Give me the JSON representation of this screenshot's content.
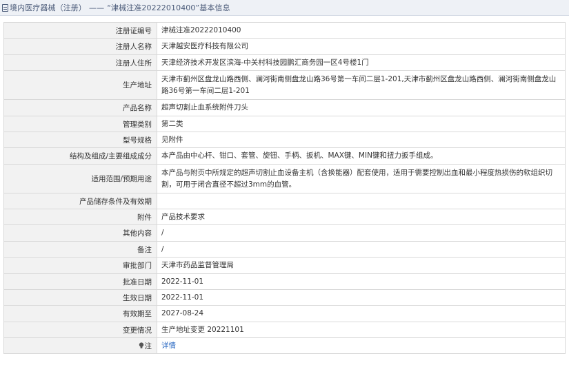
{
  "breadcrumb": {
    "section": "境内医疗器械（注册）",
    "separator": "——",
    "title": "“津械注准20222010400”基本信息"
  },
  "rows": [
    {
      "label": "注册证编号",
      "value": "津械注准20222010400"
    },
    {
      "label": "注册人名称",
      "value": "天津越安医疗科技有限公司"
    },
    {
      "label": "注册人住所",
      "value": "天津经济技术开发区滨海-中关村科技园鹏汇商务园一区4号楼1门"
    },
    {
      "label": "生产地址",
      "value": "天津市蓟州区盘龙山路西侧、澜河街南侧盘龙山路36号第一车间二层1-201,天津市蓟州区盘龙山路西侧、澜河街南侧盘龙山路36号第一车间二层1-201"
    },
    {
      "label": "产品名称",
      "value": "超声切割止血系统附件刀头"
    },
    {
      "label": "管理类别",
      "value": "第二类"
    },
    {
      "label": "型号规格",
      "value": "见附件"
    },
    {
      "label": "结构及组成/主要组成成分",
      "value": "本产品由中心杆、钳口、套管、旋钮、手柄、扳机、MAX键、MIN键和扭力扳手组成。"
    },
    {
      "label": "适用范围/预期用途",
      "value": "本产品与附页中所规定的超声切割止血设备主机（含换能器）配套使用，适用于需要控制出血和最小程度热损伤的软组织切割，可用于闭合直径不超过3mm的血管。"
    },
    {
      "label": "产品储存条件及有效期",
      "value": ""
    },
    {
      "label": "附件",
      "value": "产品技术要求"
    },
    {
      "label": "其他内容",
      "value": "/"
    },
    {
      "label": "备注",
      "value": "/"
    },
    {
      "label": "审批部门",
      "value": "天津市药品监督管理局"
    },
    {
      "label": "批准日期",
      "value": "2022-11-01"
    },
    {
      "label": "生效日期",
      "value": "2022-11-01"
    },
    {
      "label": "有效期至",
      "value": "2027-08-24"
    },
    {
      "label": "变更情况",
      "value": "生产地址变更 20221101"
    }
  ],
  "note_row": {
    "icon": "lightbulb-icon",
    "label": "注",
    "link_text": "详情"
  },
  "colors": {
    "topbar_bg": "#eef1f6",
    "label_bg": "#f2f2f2",
    "border": "#d9d9d9",
    "link": "#2f6cc4"
  }
}
